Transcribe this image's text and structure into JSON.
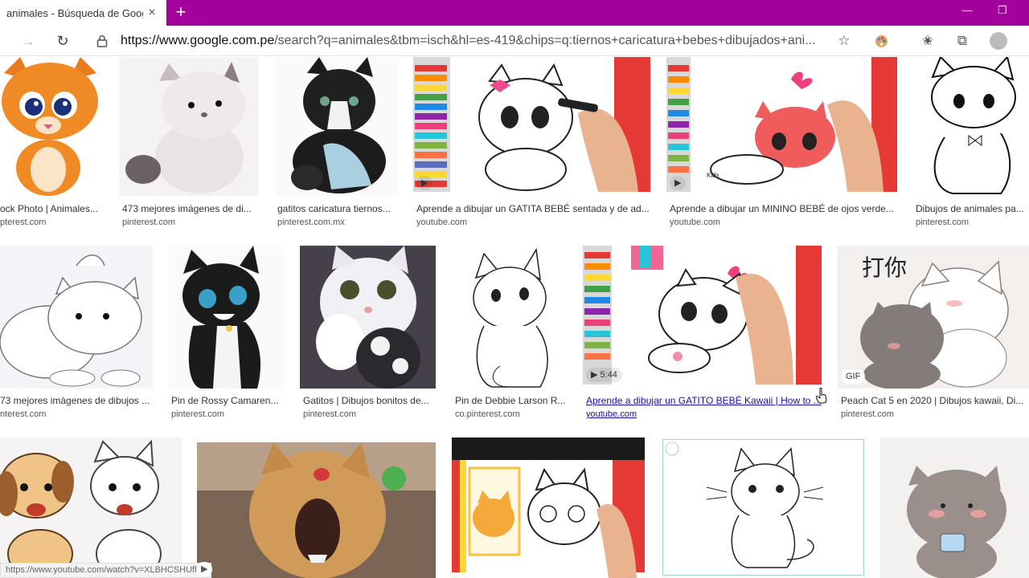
{
  "browser": {
    "tab_title": "animales - Búsqueda de Google",
    "url_host": "https://www.google.com.pe",
    "url_path": "/search?q=animales&tbm=isch&hl=es-419&chips=q:tiernos+caricatura+bebes+dibujados+ani...",
    "accent": "#a4009b"
  },
  "results": {
    "row1": [
      {
        "title": "ock Photo | Animales...",
        "source": "pterest.com",
        "kind": "cartoon-orange-cat"
      },
      {
        "title": "473 mejores imágenes de di...",
        "source": "pinterest.com",
        "kind": "cartoon-grey-cat"
      },
      {
        "title": "gatitos caricatura tiernos...",
        "source": "pinterest.com.mx",
        "kind": "black-white-kitten"
      },
      {
        "title": "Aprende a dibujar un GATITA BEBÉ sentada y de ad...",
        "source": "youtube.com",
        "kind": "video-white-kitty",
        "badge": "▶"
      },
      {
        "title": "Aprende a dibujar un MININO BEBÉ de ojos verde...",
        "source": "youtube.com",
        "kind": "video-pink-kitty",
        "badge": "▶"
      },
      {
        "title": "Dibujos de animales pa...",
        "source": "pinterest.com",
        "kind": "outline-cat"
      }
    ],
    "row2": [
      {
        "title": "73 mejores imágenes de dibujos ...",
        "source": "nterest.com",
        "kind": "fluffy-white-cat"
      },
      {
        "title": "Pin de Rossy Camaren...",
        "source": "pinterest.com",
        "kind": "black-cat"
      },
      {
        "title": "Gatitos | Dibujos bonitos de...",
        "source": "pinterest.com",
        "kind": "photo-white-kitten"
      },
      {
        "title": "Pin de Debbie Larson R...",
        "source": "co.pinterest.com",
        "kind": "sketch-kitten"
      },
      {
        "title": "Aprende a dibujar un GATITO BEBÉ Kawaii | How to ...",
        "source": "youtube.com",
        "kind": "video-kawaii-kitten",
        "badge": "▶ 5:44"
      },
      {
        "title": "Peach Cat 5 en 2020 | Dibujos kawaii, Di...",
        "source": "pinterest.com",
        "kind": "peach-cat",
        "badge": "GIF",
        "overlay_text": "打你"
      }
    ],
    "row3": [
      {
        "kind": "dog-and-cat"
      },
      {
        "kind": "photo-yawning-kitten"
      },
      {
        "kind": "video-drawing-cats"
      },
      {
        "kind": "outline-tabby"
      },
      {
        "kind": "grey-kawaii-cat"
      }
    ]
  },
  "status_bar": {
    "text": "https://www.youtube.com/watch?v=XLBHCSHUfhE",
    "badge": "▶"
  }
}
